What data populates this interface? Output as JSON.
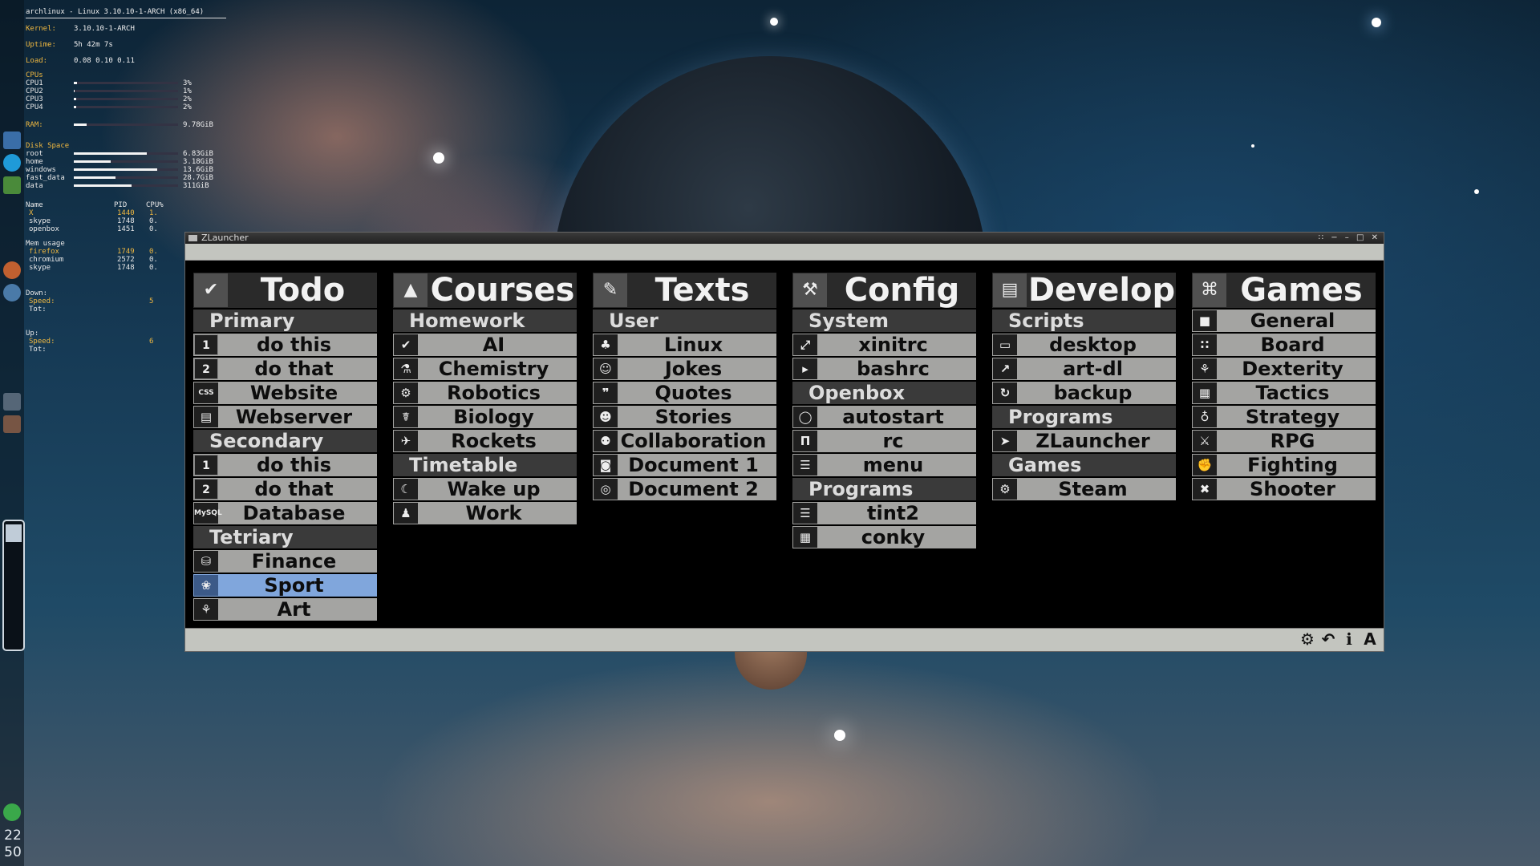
{
  "conky": {
    "header": "archlinux - Linux 3.10.10-1-ARCH (x86_64)",
    "kernel_label": "Kernel:",
    "kernel_value": "3.10.10-1-ARCH",
    "uptime_label": "Uptime:",
    "uptime_value": "5h 42m 7s",
    "load_label": "Load:",
    "load_value": "0.08 0.10 0.11",
    "cpus_label": "CPUs",
    "cpus": [
      {
        "name": "CPU1",
        "value": "3%",
        "level": 0.03
      },
      {
        "name": "CPU2",
        "value": "1%",
        "level": 0.01
      },
      {
        "name": "CPU3",
        "value": "2%",
        "level": 0.02
      },
      {
        "name": "CPU4",
        "value": "2%",
        "level": 0.02
      }
    ],
    "ram_label": "RAM:",
    "ram_value": "9.78GiB",
    "ram_level": 0.12,
    "disk_label": "Disk Space",
    "disks": [
      {
        "name": "root",
        "value": "6.83GiB",
        "level": 0.7
      },
      {
        "name": "home",
        "value": "3.18GiB",
        "level": 0.35
      },
      {
        "name": "windows",
        "value": "13.6GiB",
        "level": 0.8
      },
      {
        "name": "fast_data",
        "value": "28.7GiB",
        "level": 0.4
      },
      {
        "name": "data",
        "value": "311GiB",
        "level": 0.55
      }
    ],
    "proc_name_label": "Name",
    "proc_pid_label": "PID",
    "proc_cpu_label": "CPU%",
    "procs": [
      {
        "name": "X",
        "pid": "1440",
        "cpu": "1."
      },
      {
        "name": "skype",
        "pid": "1748",
        "cpu": "0."
      },
      {
        "name": "openbox",
        "pid": "1451",
        "cpu": "0."
      }
    ],
    "mem_label": "Mem usage",
    "mems": [
      {
        "name": "firefox",
        "pid": "1749",
        "cpu": "0."
      },
      {
        "name": "chromium",
        "pid": "2572",
        "cpu": "0."
      },
      {
        "name": "skype",
        "pid": "1748",
        "cpu": "0."
      }
    ],
    "down_label": "Down:",
    "down_speed_label": "Speed:",
    "down_speed_value": "5",
    "down_tot_label": "Tot:",
    "up_label": "Up:",
    "up_speed_label": "Speed:",
    "up_speed_value": "6",
    "up_tot_label": "Tot:"
  },
  "clock": {
    "hour": "22",
    "minute": "50"
  },
  "window": {
    "title": "ZLauncher",
    "controls": "∷ − – □ ✕"
  },
  "columns": [
    {
      "title": "Todo",
      "icon": "✔",
      "groups": [
        {
          "label": "Primary",
          "items": [
            {
              "label": "do this",
              "icon": "1",
              "iconname": "number-one-icon"
            },
            {
              "label": "do that",
              "icon": "2",
              "iconname": "number-two-icon"
            },
            {
              "label": "Website",
              "icon": "CSS",
              "iconname": "css-icon"
            },
            {
              "label": "Webserver",
              "icon": "▤",
              "iconname": "server-icon"
            }
          ]
        },
        {
          "label": "Secondary",
          "items": [
            {
              "label": "do this",
              "icon": "1",
              "iconname": "number-one-icon"
            },
            {
              "label": "do that",
              "icon": "2",
              "iconname": "number-two-icon"
            },
            {
              "label": "Database",
              "icon": "MySQL",
              "iconname": "mysql-icon"
            }
          ]
        },
        {
          "label": "Tetriary",
          "items": [
            {
              "label": "Finance",
              "icon": "⛁",
              "iconname": "coins-icon"
            },
            {
              "label": "Sport",
              "icon": "❀",
              "iconname": "racket-icon",
              "selected": true
            },
            {
              "label": "Art",
              "icon": "⚘",
              "iconname": "tree-icon"
            }
          ]
        }
      ]
    },
    {
      "title": "Courses",
      "icon": "▲",
      "groups": [
        {
          "label": "Homework",
          "items": [
            {
              "label": "AI",
              "icon": "✔",
              "iconname": "check-badge-icon"
            },
            {
              "label": "Chemistry",
              "icon": "⚗",
              "iconname": "flask-icon"
            },
            {
              "label": "Robotics",
              "icon": "⚙",
              "iconname": "robot-arm-icon"
            },
            {
              "label": "Biology",
              "icon": "☤",
              "iconname": "dna-icon"
            },
            {
              "label": "Rockets",
              "icon": "✈",
              "iconname": "rocket-icon"
            }
          ]
        },
        {
          "label": "Timetable",
          "items": [
            {
              "label": "Wake up",
              "icon": "☾",
              "iconname": "moon-icon"
            },
            {
              "label": "Work",
              "icon": "♟",
              "iconname": "person-icon"
            }
          ]
        }
      ]
    },
    {
      "title": "Texts",
      "icon": "✎",
      "groups": [
        {
          "label": "User",
          "items": [
            {
              "label": "Linux",
              "icon": "♣",
              "iconname": "tux-icon"
            },
            {
              "label": "Jokes",
              "icon": "☺",
              "iconname": "smiley-icon"
            },
            {
              "label": "Quotes",
              "icon": "❞",
              "iconname": "quote-icon"
            },
            {
              "label": "Stories",
              "icon": "☻",
              "iconname": "storyteller-icon"
            },
            {
              "label": "Collaboration",
              "icon": "⚉",
              "iconname": "group-icon"
            },
            {
              "label": "Document 1",
              "icon": "◙",
              "iconname": "harddisk-icon"
            },
            {
              "label": "Document 2",
              "icon": "◎",
              "iconname": "disc-icon"
            }
          ]
        }
      ]
    },
    {
      "title": "Config",
      "icon": "⚒",
      "groups": [
        {
          "label": "System",
          "items": [
            {
              "label": "xinitrc",
              "icon": "⤢",
              "iconname": "expand-icon"
            },
            {
              "label": "bashrc",
              "icon": "▸",
              "iconname": "terminal-icon"
            }
          ]
        },
        {
          "label": "Openbox",
          "items": [
            {
              "label": "autostart",
              "icon": "◯",
              "iconname": "circle-icon"
            },
            {
              "label": "rc",
              "icon": "Π",
              "iconname": "openbox-icon"
            },
            {
              "label": "menu",
              "icon": "☰",
              "iconname": "list-icon"
            }
          ]
        },
        {
          "label": "Programs",
          "items": [
            {
              "label": "tint2",
              "icon": "☰",
              "iconname": "taskbar-icon"
            },
            {
              "label": "conky",
              "icon": "▦",
              "iconname": "table-icon"
            }
          ]
        }
      ]
    },
    {
      "title": "Develop",
      "icon": "▤",
      "groups": [
        {
          "label": "Scripts",
          "items": [
            {
              "label": "desktop",
              "icon": "▭",
              "iconname": "monitor-icon"
            },
            {
              "label": "art-dl",
              "icon": "↗",
              "iconname": "download-arrow-icon"
            },
            {
              "label": "backup",
              "icon": "↻",
              "iconname": "backup-icon"
            }
          ]
        },
        {
          "label": "Programs",
          "items": [
            {
              "label": "ZLauncher",
              "icon": "➤",
              "iconname": "paper-plane-icon"
            }
          ]
        },
        {
          "label": "Games",
          "items": [
            {
              "label": "Steam",
              "icon": "⚙",
              "iconname": "steam-icon"
            }
          ]
        }
      ]
    },
    {
      "title": "Games",
      "icon": "⌘",
      "groups": [
        {
          "label": "",
          "items": [
            {
              "label": "General",
              "icon": "■",
              "iconname": "square-icon"
            },
            {
              "label": "Board",
              "icon": "∷",
              "iconname": "dots-icon"
            },
            {
              "label": "Dexterity",
              "icon": "⚘",
              "iconname": "juggler-icon"
            },
            {
              "label": "Tactics",
              "icon": "▦",
              "iconname": "grid-icon"
            },
            {
              "label": "Strategy",
              "icon": "♁",
              "iconname": "globe-icon"
            },
            {
              "label": "RPG",
              "icon": "⚔",
              "iconname": "bicep-icon"
            },
            {
              "label": "Fighting",
              "icon": "✊",
              "iconname": "fist-icon"
            },
            {
              "label": "Shooter",
              "icon": "✖",
              "iconname": "gun-icon"
            }
          ]
        }
      ]
    }
  ],
  "toolbar": {
    "settings": "⚙",
    "back": "↶",
    "info": "ℹ",
    "font": "A"
  }
}
